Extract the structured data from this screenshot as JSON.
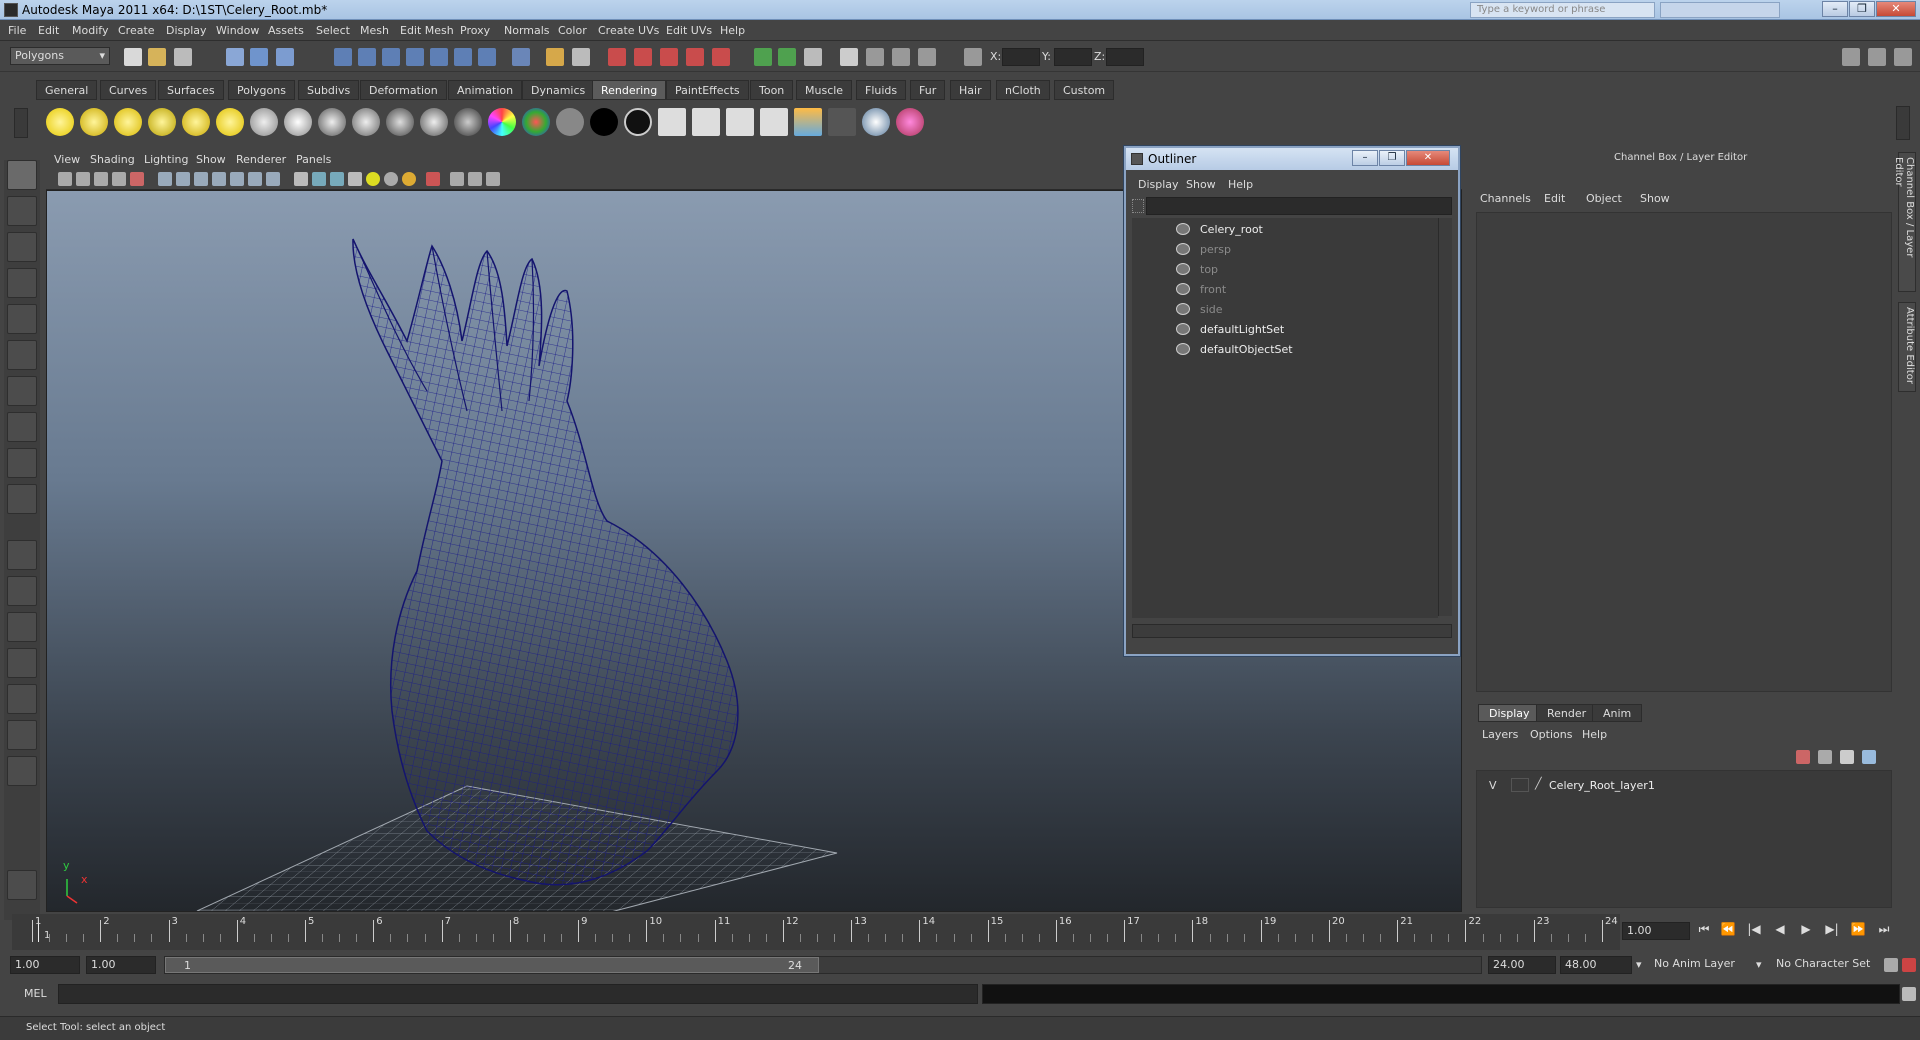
{
  "window": {
    "title": "Autodesk Maya 2011 x64: D:\\1ST\\Celery_Root.mb*",
    "search_placeholder": "Type a keyword or phrase"
  },
  "menubar": [
    "File",
    "Edit",
    "Modify",
    "Create",
    "Display",
    "Window",
    "Assets",
    "Select",
    "Mesh",
    "Edit Mesh",
    "Proxy",
    "Normals",
    "Color",
    "Create UVs",
    "Edit UVs",
    "Help"
  ],
  "statusline": {
    "mode": "Polygons",
    "x_label": "X:",
    "y_label": "Y:",
    "z_label": "Z:"
  },
  "shelf": {
    "tabs": [
      "General",
      "Curves",
      "Surfaces",
      "Polygons",
      "Subdivs",
      "Deformation",
      "Animation",
      "Dynamics",
      "Rendering",
      "PaintEffects",
      "Toon",
      "Muscle",
      "Fluids",
      "Fur",
      "Hair",
      "nCloth",
      "Custom"
    ],
    "active_tab": "Rendering"
  },
  "viewport": {
    "menu": [
      "View",
      "Shading",
      "Lighting",
      "Show",
      "Renderer",
      "Panels"
    ],
    "axis_y": "y",
    "axis_x": "x",
    "wire_color": "#1a1a8a"
  },
  "outliner": {
    "title": "Outliner",
    "menu": [
      "Display",
      "Show",
      "Help"
    ],
    "items": [
      {
        "label": "Celery_root",
        "dim": false
      },
      {
        "label": "persp",
        "dim": true
      },
      {
        "label": "top",
        "dim": true
      },
      {
        "label": "front",
        "dim": true
      },
      {
        "label": "side",
        "dim": true
      },
      {
        "label": "defaultLightSet",
        "dim": false
      },
      {
        "label": "defaultObjectSet",
        "dim": false
      }
    ]
  },
  "channelbox": {
    "title": "Channel Box / Layer Editor",
    "menu": [
      "Channels",
      "Edit",
      "Object",
      "Show"
    ],
    "side_tabs": [
      "Channel Box / Layer Editor",
      "Attribute Editor"
    ]
  },
  "layereditor": {
    "tabs": [
      "Display",
      "Render",
      "Anim"
    ],
    "active_tab": "Display",
    "menu": [
      "Layers",
      "Options",
      "Help"
    ],
    "layer": {
      "visible": "V",
      "name": "Celery_Root_layer1"
    }
  },
  "timeslider": {
    "ticks": [
      1,
      2,
      3,
      4,
      5,
      6,
      7,
      8,
      9,
      10,
      11,
      12,
      13,
      14,
      15,
      16,
      17,
      18,
      19,
      20,
      21,
      22,
      23,
      24
    ],
    "current_frame": "1.00",
    "current_marker": "1"
  },
  "rangebar": {
    "start": "1.00",
    "playback_start": "1.00",
    "range_start": "1",
    "range_end": "24",
    "playback_end": "24.00",
    "end": "48.00",
    "anim_layer": "No Anim Layer",
    "character_set": "No Character Set"
  },
  "cmdline": {
    "label": "MEL"
  },
  "helpline": {
    "text": "Select Tool: select an object"
  }
}
